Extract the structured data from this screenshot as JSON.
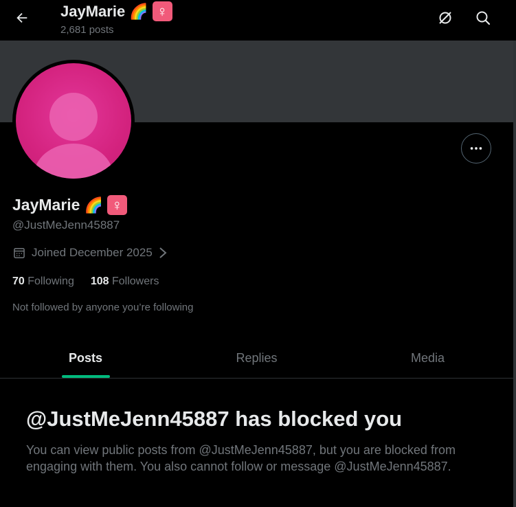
{
  "header": {
    "title": "JayMarie",
    "posts_count": "2,681 posts"
  },
  "profile": {
    "name": "JayMarie",
    "handle": "@JustMeJenn45887",
    "joined": "Joined December 2025",
    "following_count": "70",
    "following_label": "Following",
    "followers_count": "108",
    "followers_label": "Followers",
    "not_followed_text": "Not followed by anyone you’re following",
    "emoji_flag": "🌈",
    "emoji_venus": "♀"
  },
  "tabs": [
    {
      "label": "Posts",
      "active": true
    },
    {
      "label": "Replies",
      "active": false
    },
    {
      "label": "Media",
      "active": false
    }
  ],
  "blocked": {
    "title": "@JustMeJenn45887 has blocked you",
    "message": "You can view public posts from @JustMeJenn45887, but you are blocked from engaging with them. You also cannot follow or message @JustMeJenn45887."
  },
  "colors": {
    "accent_tab_indicator": "#00ba7c",
    "avatar": "#d4237f",
    "banner": "#333639"
  },
  "icons": [
    "back-arrow-icon",
    "grok-icon",
    "search-icon",
    "more-icon",
    "calendar-icon",
    "chevron-right-icon"
  ]
}
